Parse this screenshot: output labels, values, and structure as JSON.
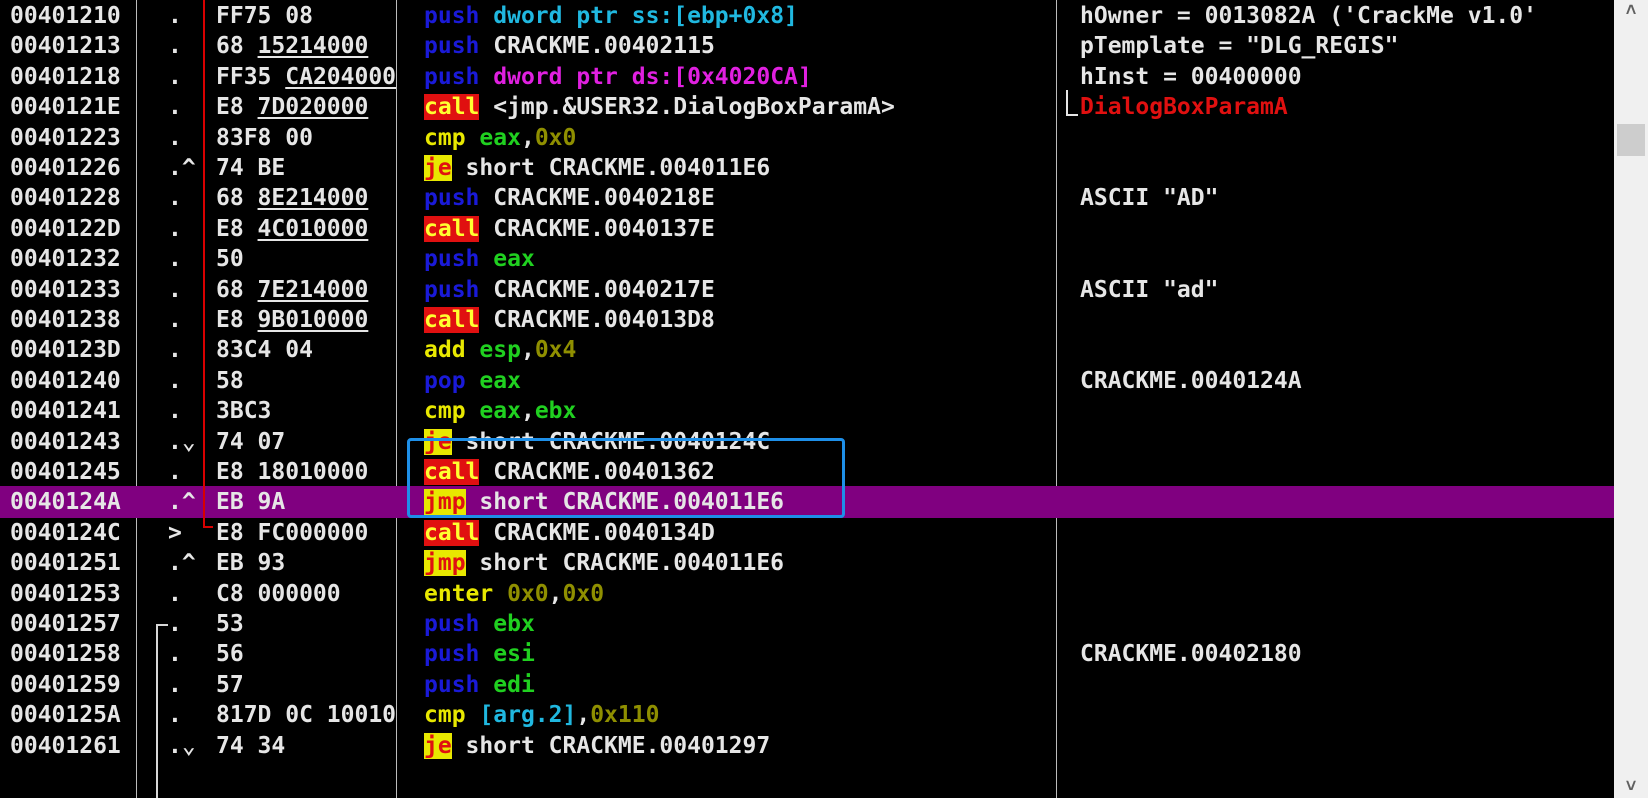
{
  "rows": [
    {
      "addr": "00401210",
      "mk": ".",
      "hex": [
        {
          "t": "FF75 08"
        }
      ],
      "dis": [
        {
          "t": "push",
          "c": "kw-blue"
        },
        {
          "t": " "
        },
        {
          "t": "dword ptr ss:[ebp+0x8]",
          "c": "mem"
        }
      ],
      "com": [
        {
          "t": "hOwner = 0013082A ('CrackMe v1.0'",
          "c": "txt"
        }
      ]
    },
    {
      "addr": "00401213",
      "mk": ".",
      "hex": [
        {
          "t": "68 "
        },
        {
          "t": "15214000",
          "u": true
        }
      ],
      "dis": [
        {
          "t": "push",
          "c": "kw-blue"
        },
        {
          "t": " CRACKME.00402115",
          "c": "txt"
        }
      ],
      "com": [
        {
          "t": "pTemplate = \"DLG_REGIS\"",
          "c": "txt"
        }
      ]
    },
    {
      "addr": "00401218",
      "mk": ".",
      "hex": [
        {
          "t": "FF35 "
        },
        {
          "t": "CA204000",
          "u": true
        }
      ],
      "dis": [
        {
          "t": "push",
          "c": "kw-blue"
        },
        {
          "t": " "
        },
        {
          "t": "dword ptr ds:[0x4020CA]",
          "c": "seg"
        }
      ],
      "com": [
        {
          "t": "hInst = 00400000",
          "c": "txt"
        }
      ]
    },
    {
      "addr": "0040121E",
      "mk": ".",
      "hex": [
        {
          "t": "E8 "
        },
        {
          "t": "7D020000",
          "u": true
        }
      ],
      "dis": [
        {
          "t": "call",
          "c": "kw-bad"
        },
        {
          "t": " <jmp.&USER32.DialogBoxParamA>",
          "c": "txt"
        }
      ],
      "com": [
        {
          "t": "DialogBoxParamA",
          "c": "red"
        }
      ]
    },
    {
      "addr": "00401223",
      "mk": ".",
      "hex": [
        {
          "t": "83F8 00"
        }
      ],
      "dis": [
        {
          "t": "cmp",
          "c": "kw-yel"
        },
        {
          "t": " "
        },
        {
          "t": "eax",
          "c": "reg"
        },
        {
          "t": ",",
          "c": "txt"
        },
        {
          "t": "0x0",
          "c": "num"
        }
      ],
      "com": []
    },
    {
      "addr": "00401226",
      "mk": ".^",
      "hex": [
        {
          "t": "74 BE"
        }
      ],
      "dis": [
        {
          "t": "je",
          "c": "kw-jmp"
        },
        {
          "t": " short CRACKME.004011E6",
          "c": "txt"
        }
      ],
      "com": []
    },
    {
      "addr": "00401228",
      "mk": ".",
      "hex": [
        {
          "t": "68 "
        },
        {
          "t": "8E214000",
          "u": true
        }
      ],
      "dis": [
        {
          "t": "push",
          "c": "kw-blue"
        },
        {
          "t": " CRACKME.0040218E",
          "c": "txt"
        }
      ],
      "com": [
        {
          "t": "ASCII \"AD\"",
          "c": "txt"
        }
      ]
    },
    {
      "addr": "0040122D",
      "mk": ".",
      "hex": [
        {
          "t": "E8 "
        },
        {
          "t": "4C010000",
          "u": true
        }
      ],
      "dis": [
        {
          "t": "call",
          "c": "kw-bad"
        },
        {
          "t": " CRACKME.0040137E",
          "c": "txt"
        }
      ],
      "com": []
    },
    {
      "addr": "00401232",
      "mk": ".",
      "hex": [
        {
          "t": "50"
        }
      ],
      "dis": [
        {
          "t": "push",
          "c": "kw-blue"
        },
        {
          "t": " "
        },
        {
          "t": "eax",
          "c": "reg"
        }
      ],
      "com": []
    },
    {
      "addr": "00401233",
      "mk": ".",
      "hex": [
        {
          "t": "68 "
        },
        {
          "t": "7E214000",
          "u": true
        }
      ],
      "dis": [
        {
          "t": "push",
          "c": "kw-blue"
        },
        {
          "t": " CRACKME.0040217E",
          "c": "txt"
        }
      ],
      "com": [
        {
          "t": "ASCII \"ad\"",
          "c": "txt"
        }
      ]
    },
    {
      "addr": "00401238",
      "mk": ".",
      "hex": [
        {
          "t": "E8 "
        },
        {
          "t": "9B010000",
          "u": true
        }
      ],
      "dis": [
        {
          "t": "call",
          "c": "kw-bad"
        },
        {
          "t": " CRACKME.004013D8",
          "c": "txt"
        }
      ],
      "com": []
    },
    {
      "addr": "0040123D",
      "mk": ".",
      "hex": [
        {
          "t": "83C4 04"
        }
      ],
      "dis": [
        {
          "t": "add",
          "c": "kw-yel"
        },
        {
          "t": " "
        },
        {
          "t": "esp",
          "c": "reg"
        },
        {
          "t": ",",
          "c": "txt"
        },
        {
          "t": "0x4",
          "c": "num"
        }
      ],
      "com": []
    },
    {
      "addr": "00401240",
      "mk": ".",
      "hex": [
        {
          "t": "58"
        }
      ],
      "dis": [
        {
          "t": "pop",
          "c": "kw-blue"
        },
        {
          "t": " "
        },
        {
          "t": "eax",
          "c": "reg"
        }
      ],
      "com": [
        {
          "t": "CRACKME.0040124A",
          "c": "txt"
        }
      ]
    },
    {
      "addr": "00401241",
      "mk": ".",
      "hex": [
        {
          "t": "3BC3"
        }
      ],
      "dis": [
        {
          "t": "cmp",
          "c": "kw-yel"
        },
        {
          "t": " "
        },
        {
          "t": "eax",
          "c": "reg"
        },
        {
          "t": ",",
          "c": "txt"
        },
        {
          "t": "ebx",
          "c": "reg"
        }
      ],
      "com": []
    },
    {
      "addr": "00401243",
      "mk": ".⌄",
      "hex": [
        {
          "t": "74 07"
        }
      ],
      "dis": [
        {
          "t": "je",
          "c": "kw-jmp"
        },
        {
          "t": " short CRACKME.0040124C",
          "c": "txt"
        }
      ],
      "com": []
    },
    {
      "addr": "00401245",
      "mk": ".",
      "hex": [
        {
          "t": "E8 18010000"
        }
      ],
      "dis": [
        {
          "t": "call",
          "c": "kw-bad"
        },
        {
          "t": " CRACKME.00401362",
          "c": "txt"
        }
      ],
      "com": []
    },
    {
      "addr": "0040124A",
      "mk": ".^",
      "hl": true,
      "hex": [
        {
          "t": "EB 9A"
        }
      ],
      "dis": [
        {
          "t": "jmp",
          "c": "kw-jmp"
        },
        {
          "t": " short CRACKME.004011E6",
          "c": "txt"
        }
      ],
      "com": []
    },
    {
      "addr": "0040124C",
      "mk": ">",
      "hex": [
        {
          "t": "E8 FC000000"
        }
      ],
      "dis": [
        {
          "t": "call",
          "c": "kw-bad"
        },
        {
          "t": " CRACKME.0040134D",
          "c": "txt"
        }
      ],
      "com": []
    },
    {
      "addr": "00401251",
      "mk": ".^",
      "hex": [
        {
          "t": "EB 93"
        }
      ],
      "dis": [
        {
          "t": "jmp",
          "c": "kw-jmp"
        },
        {
          "t": " short CRACKME.004011E6",
          "c": "txt"
        }
      ],
      "com": []
    },
    {
      "addr": "00401253",
      "mk": ".",
      "hex": [
        {
          "t": "C8 000000"
        }
      ],
      "dis": [
        {
          "t": "enter",
          "c": "kw-yel"
        },
        {
          "t": " "
        },
        {
          "t": "0x0",
          "c": "num"
        },
        {
          "t": ",",
          "c": "txt"
        },
        {
          "t": "0x0",
          "c": "num"
        }
      ],
      "com": []
    },
    {
      "addr": "00401257",
      "mk": ".",
      "hex": [
        {
          "t": "53"
        }
      ],
      "dis": [
        {
          "t": "push",
          "c": "kw-blue"
        },
        {
          "t": " "
        },
        {
          "t": "ebx",
          "c": "reg"
        }
      ],
      "com": []
    },
    {
      "addr": "00401258",
      "mk": ".",
      "hex": [
        {
          "t": "56"
        }
      ],
      "dis": [
        {
          "t": "push",
          "c": "kw-blue"
        },
        {
          "t": " "
        },
        {
          "t": "esi",
          "c": "reg"
        }
      ],
      "com": [
        {
          "t": "CRACKME.00402180",
          "c": "txt"
        }
      ]
    },
    {
      "addr": "00401259",
      "mk": ".",
      "hex": [
        {
          "t": "57"
        }
      ],
      "dis": [
        {
          "t": "push",
          "c": "kw-blue"
        },
        {
          "t": " "
        },
        {
          "t": "edi",
          "c": "reg"
        }
      ],
      "com": []
    },
    {
      "addr": "0040125A",
      "mk": ".",
      "hex": [
        {
          "t": "817D 0C 10010"
        }
      ],
      "dis": [
        {
          "t": "cmp",
          "c": "kw-yel"
        },
        {
          "t": " "
        },
        {
          "t": "[arg.2]",
          "c": "mem"
        },
        {
          "t": ",",
          "c": "txt"
        },
        {
          "t": "0x110",
          "c": "num"
        }
      ],
      "com": []
    },
    {
      "addr": "00401261",
      "mk": ".⌄",
      "hex": [
        {
          "t": "74 34"
        }
      ],
      "dis": [
        {
          "t": "je",
          "c": "kw-jmp"
        },
        {
          "t": " short CRACKME.00401297",
          "c": "txt"
        }
      ],
      "com": []
    }
  ],
  "scrollbar": {
    "up_glyph": "˄",
    "down_glyph": "˅"
  },
  "colors": {
    "background": "#000000",
    "highlight_row": "#800080",
    "selection_box": "#1e8fe8",
    "jump_line": "#d80000",
    "push_pop": "#1a1ad8",
    "arith": "#e8e800",
    "call_bg": "#e01010",
    "jump_bg": "#e8e800",
    "register": "#20d020",
    "memory": "#20b8e0",
    "segment_mem": "#e020e0",
    "immediate": "#8f8f00"
  }
}
